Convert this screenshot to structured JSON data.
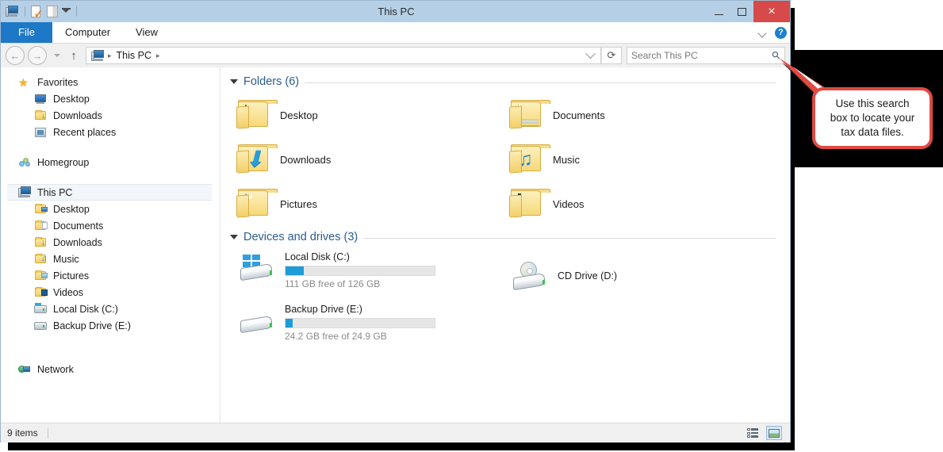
{
  "window": {
    "title": "This PC",
    "quick_access": [
      {
        "name": "this-pc-icon",
        "label": "This PC"
      },
      {
        "name": "properties-icon",
        "label": "Properties"
      },
      {
        "name": "new-folder-icon",
        "label": "New folder"
      },
      {
        "name": "customize-quick-access-icon",
        "label": "Customize Quick Access Toolbar"
      }
    ],
    "controls": {
      "minimize": "Minimize",
      "maximize": "Maximize",
      "close": "×"
    }
  },
  "ribbon": {
    "tabs": [
      {
        "label": "File",
        "active": true
      },
      {
        "label": "Computer",
        "active": false
      },
      {
        "label": "View",
        "active": false
      }
    ],
    "expand_label": "Expand the Ribbon",
    "help_label": "?"
  },
  "address_bar": {
    "back": "←",
    "forward": "→",
    "recent": "Recent locations",
    "up": "↑",
    "crumbs": [
      "This PC"
    ],
    "separator": "▸",
    "dropdown": "Previous Locations",
    "refresh": "⟳"
  },
  "search": {
    "placeholder": "Search This PC",
    "icon": "search-icon"
  },
  "sidebar": {
    "groups": [
      {
        "name": "favorites",
        "label": "Favorites",
        "icon": "star-icon",
        "items": [
          {
            "label": "Desktop",
            "icon": "monitor-icon"
          },
          {
            "label": "Downloads",
            "icon": "folder-download-icon"
          },
          {
            "label": "Recent places",
            "icon": "recent-places-icon"
          }
        ]
      },
      {
        "name": "homegroup",
        "label": "Homegroup",
        "icon": "homegroup-icon",
        "items": []
      },
      {
        "name": "this-pc",
        "label": "This PC",
        "icon": "this-pc-icon",
        "selected": true,
        "items": [
          {
            "label": "Desktop",
            "icon": "folder-desktop-icon"
          },
          {
            "label": "Documents",
            "icon": "folder-documents-icon"
          },
          {
            "label": "Downloads",
            "icon": "folder-download-icon"
          },
          {
            "label": "Music",
            "icon": "folder-music-icon"
          },
          {
            "label": "Pictures",
            "icon": "folder-pictures-icon"
          },
          {
            "label": "Videos",
            "icon": "folder-videos-icon"
          },
          {
            "label": "Local Disk (C:)",
            "icon": "hard-drive-icon"
          },
          {
            "label": "Backup Drive (E:)",
            "icon": "hard-drive-icon"
          }
        ]
      },
      {
        "name": "network",
        "label": "Network",
        "icon": "network-icon",
        "items": []
      }
    ]
  },
  "content": {
    "folders_group": {
      "title": "Folders (6)",
      "items": [
        {
          "label": "Desktop",
          "icon": "folder-desktop-icon"
        },
        {
          "label": "Documents",
          "icon": "folder-documents-icon"
        },
        {
          "label": "Downloads",
          "icon": "folder-downloads-icon"
        },
        {
          "label": "Music",
          "icon": "folder-music-icon"
        },
        {
          "label": "Pictures",
          "icon": "folder-pictures-icon"
        },
        {
          "label": "Videos",
          "icon": "folder-videos-icon"
        }
      ]
    },
    "drives_group": {
      "title": "Devices and drives (3)",
      "items": [
        {
          "label": "Local Disk (C:)",
          "icon": "local-disk-icon",
          "free_text": "111 GB free of 126 GB",
          "used_percent": 12,
          "has_bar": true
        },
        {
          "label": "CD Drive (D:)",
          "icon": "cd-drive-icon",
          "free_text": "",
          "used_percent": 0,
          "has_bar": false
        },
        {
          "label": "Backup Drive (E:)",
          "icon": "hard-drive-icon",
          "free_text": "24.2 GB free of 24.9 GB",
          "used_percent": 3,
          "has_bar": true
        }
      ]
    }
  },
  "status_bar": {
    "item_count": "9 items",
    "views": [
      {
        "name": "details-view-button",
        "label": "Details view",
        "active": false
      },
      {
        "name": "large-icons-view-button",
        "label": "Large icons view",
        "active": true
      }
    ]
  },
  "callout": {
    "line1": "Use this search",
    "line2": "box to locate your",
    "line3": "tax data files.",
    "border_color": "#e04a42"
  },
  "colors": {
    "titlebar": "#b5d0e6",
    "file_tab": "#1e78c8",
    "close_button": "#d64a4a",
    "group_title": "#2a5d8f",
    "progress_fill": "#1f9bd8",
    "callout_red": "#e04a42"
  }
}
